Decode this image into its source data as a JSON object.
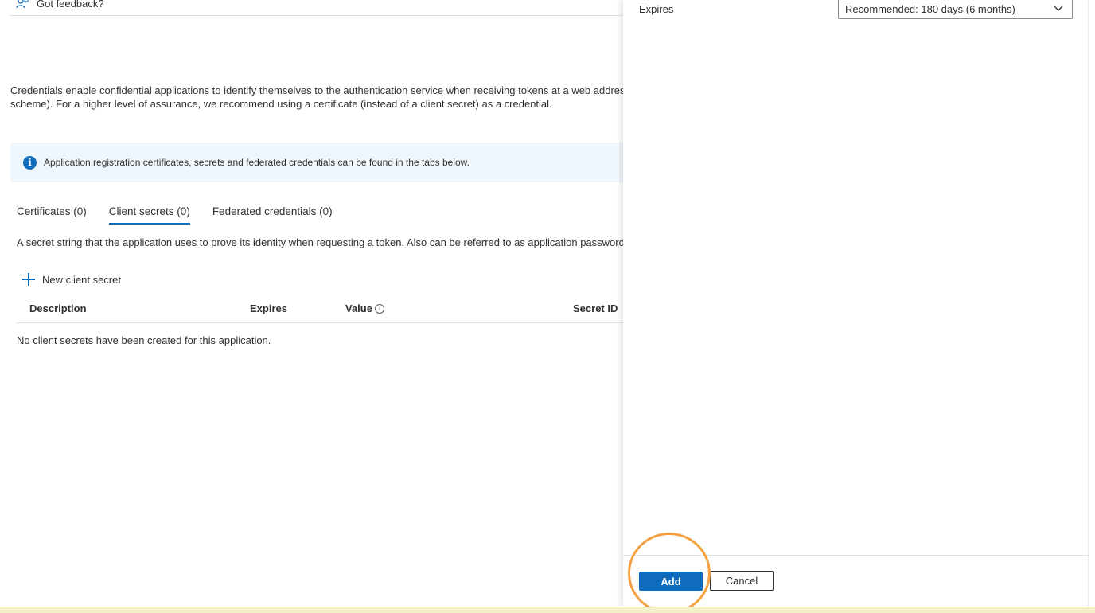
{
  "feedback": {
    "label": "Got feedback?"
  },
  "main": {
    "description_line1": "Credentials enable confidential applications to identify themselves to the authentication service when receiving tokens at a web address",
    "description_line2": "scheme). For a higher level of assurance, we recommend using a certificate (instead of a client secret) as a credential.",
    "info_bar": "Application registration certificates, secrets and federated credentials can be found in the tabs below.",
    "tabs": [
      {
        "label": "Certificates (0)",
        "active": false
      },
      {
        "label": "Client secrets (0)",
        "active": true
      },
      {
        "label": "Federated credentials (0)",
        "active": false
      }
    ],
    "tab_description": "A secret string that the application uses to prove its identity when requesting a token. Also can be referred to as application password.",
    "new_button": "New client secret",
    "table": {
      "headers": [
        "Description",
        "Expires",
        "Value",
        "Secret ID"
      ],
      "empty_message": "No client secrets have been created for this application."
    }
  },
  "panel": {
    "expires_label": "Expires",
    "expires_selected": "Recommended: 180 days (6 months)",
    "add_label": "Add",
    "cancel_label": "Cancel"
  },
  "colors": {
    "accent": "#0f6cbd",
    "info_bg": "#eff6fc",
    "highlight": "#f4a041"
  }
}
